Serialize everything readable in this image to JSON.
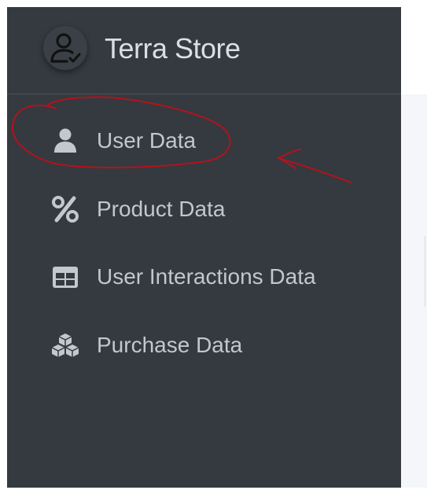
{
  "brand": {
    "name": "Terra Store",
    "logo_icon": "user-check-icon"
  },
  "sidebar": {
    "items": [
      {
        "label": "User Data",
        "icon": "user-icon",
        "annotated": true
      },
      {
        "label": "Product Data",
        "icon": "percent-icon"
      },
      {
        "label": "User Interactions Data",
        "icon": "table-icon"
      },
      {
        "label": "Purchase Data",
        "icon": "cubes-icon"
      }
    ]
  },
  "colors": {
    "sidebar_bg": "#343a40",
    "nav_text": "#c2c7d0",
    "brand_text": "#dadfe4",
    "annotation": "#b5121b"
  }
}
